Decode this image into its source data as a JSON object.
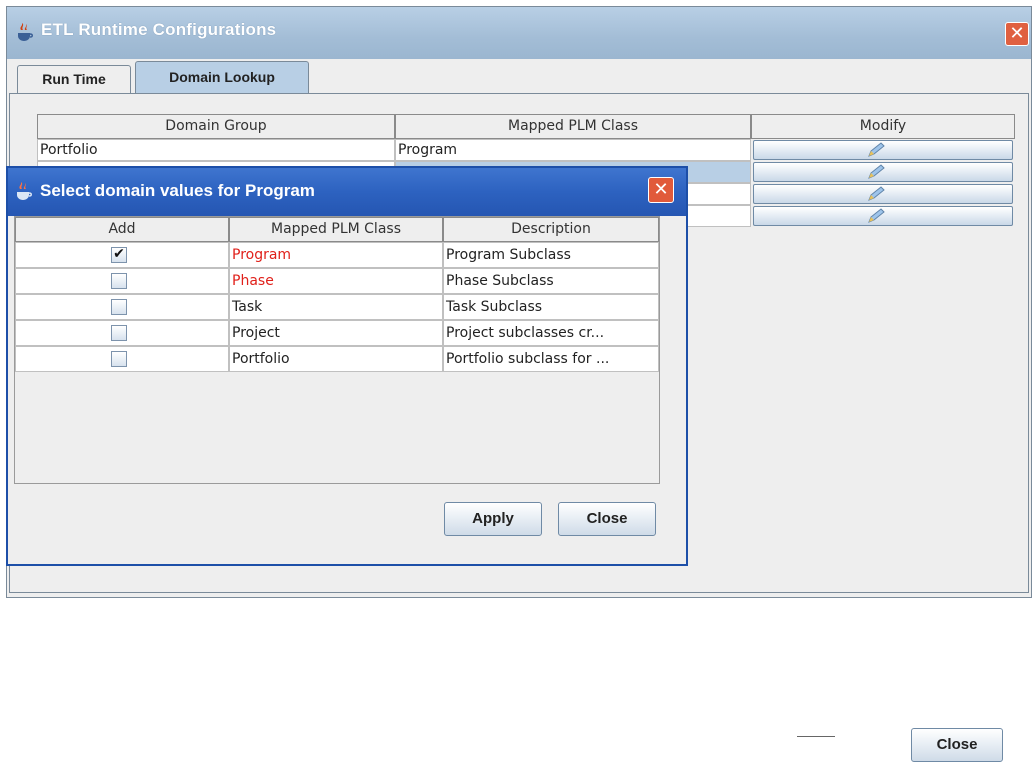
{
  "main_window": {
    "title": "ETL Runtime Configurations",
    "tabs": [
      {
        "label": "Run Time",
        "selected": false
      },
      {
        "label": "Domain Lookup",
        "selected": true
      }
    ],
    "table": {
      "columns": [
        "Domain Group",
        "Mapped PLM Class",
        "Modify"
      ],
      "rows": [
        {
          "domain_group": "Portfolio",
          "mapped_plm_class": "Program"
        },
        {
          "domain_group": "",
          "mapped_plm_class": ""
        },
        {
          "domain_group": "",
          "mapped_plm_class": ""
        },
        {
          "domain_group": "",
          "mapped_plm_class": ""
        }
      ]
    },
    "close_label": "Close"
  },
  "dialog": {
    "title": "Select domain values for  Program",
    "table": {
      "columns": [
        "Add",
        "Mapped PLM Class",
        "Description"
      ],
      "rows": [
        {
          "checked": true,
          "class": "Program",
          "description": "Program Subclass",
          "highlight": true
        },
        {
          "checked": false,
          "class": "Phase",
          "description": "Phase Subclass",
          "highlight": true
        },
        {
          "checked": false,
          "class": "Task",
          "description": "Task Subclass",
          "highlight": false
        },
        {
          "checked": false,
          "class": "Project",
          "description": "Project subclasses cr...",
          "highlight": false
        },
        {
          "checked": false,
          "class": "Portfolio",
          "description": "Portfolio subclass for ...",
          "highlight": false
        }
      ]
    },
    "apply_label": "Apply",
    "close_label": "Close"
  },
  "colors": {
    "main_titlebar": "#a3bdd6",
    "dialog_titlebar": "#2d62c0",
    "highlight_text": "#e0201a",
    "selected_tab": "#b8cfe5"
  },
  "icons": {
    "window_icon": "java-cup-icon",
    "modify_icon": "pencil-icon",
    "close_icon": "close-x-icon"
  }
}
